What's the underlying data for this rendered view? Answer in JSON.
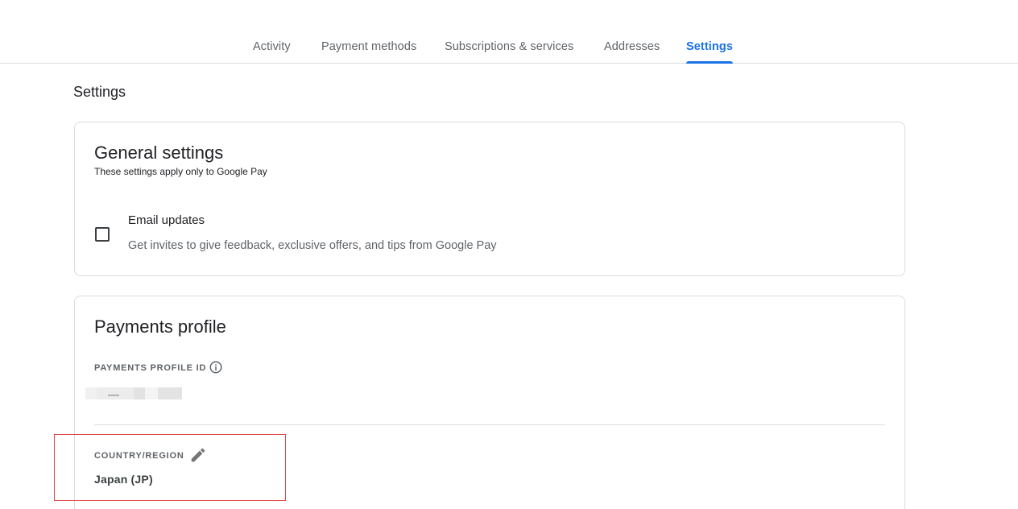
{
  "tabs": [
    {
      "label": "Activity"
    },
    {
      "label": "Payment methods"
    },
    {
      "label": "Subscriptions & services"
    },
    {
      "label": "Addresses"
    },
    {
      "label": "Settings",
      "active": true
    }
  ],
  "page": {
    "title": "Settings"
  },
  "general": {
    "title": "General settings",
    "subtitle": "These settings apply only to Google Pay",
    "email_updates": {
      "label": "Email updates",
      "description": "Get invites to give feedback, exclusive offers, and tips from Google Pay",
      "checked": false
    }
  },
  "profile": {
    "title": "Payments profile",
    "id_label": "PAYMENTS PROFILE ID",
    "country_label": "COUNTRY/REGION",
    "country_value": "Japan (JP)"
  },
  "colors": {
    "accent": "#1a73e8",
    "text_secondary": "#5f6368",
    "border": "#dadce0",
    "highlight": "#e04848"
  },
  "icons": [
    "info-icon",
    "edit-pencil-icon"
  ]
}
